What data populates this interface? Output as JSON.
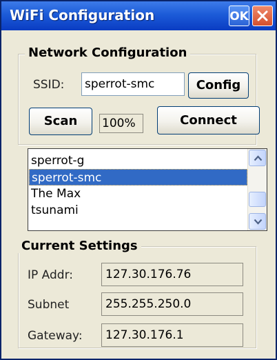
{
  "window": {
    "title": "WiFi Configuration",
    "ok_label": "OK"
  },
  "network": {
    "group_title": "Network Configuration",
    "ssid_label": "SSID:",
    "ssid_value": "sperrot-smc",
    "config_label": "Config",
    "scan_label": "Scan",
    "signal_strength": "100%",
    "connect_label": "Connect",
    "networks": [
      {
        "name": "sperrot-g",
        "selected": false
      },
      {
        "name": "sperrot-smc",
        "selected": true
      },
      {
        "name": "The Max",
        "selected": false
      },
      {
        "name": "tsunami",
        "selected": false
      }
    ]
  },
  "settings": {
    "group_title": "Current Settings",
    "ip_label": "IP Addr:",
    "ip_value": "127.30.176.76",
    "subnet_label": "Subnet",
    "subnet_value": "255.255.250.0",
    "gateway_label": "Gateway:",
    "gateway_value": "127.30.176.1"
  },
  "icons": {
    "close": "close-icon",
    "scroll_up": "chevron-up-icon",
    "scroll_down": "chevron-down-icon"
  },
  "colors": {
    "titlebar": "#0a3cc2",
    "selection": "#316ac5",
    "close_button": "#d3502f"
  }
}
